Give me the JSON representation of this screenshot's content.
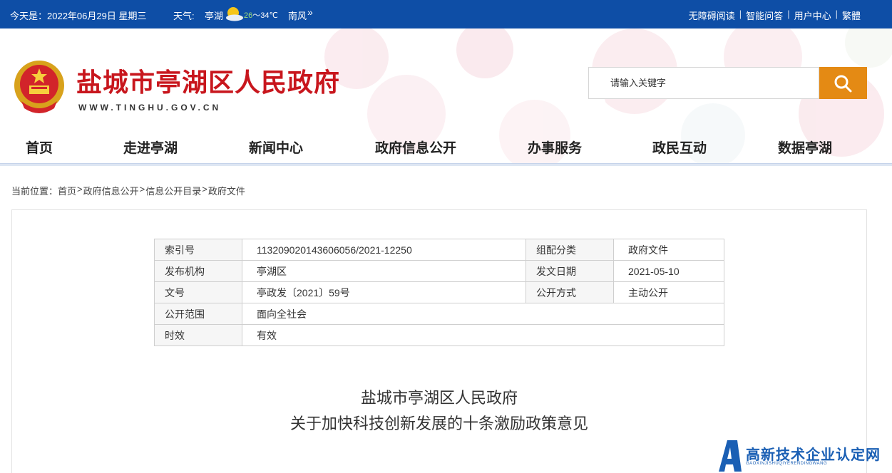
{
  "topbar": {
    "date": "今天是：2022年06月29日 星期三",
    "weather_label": "天气:",
    "location": "亭湖",
    "temp_low": "26",
    "temp_high": "～34℃",
    "wind": "南风",
    "more": "»",
    "links": [
      "无障碍阅读",
      "智能问答",
      "用户中心",
      "繁體"
    ],
    "separator": "|"
  },
  "header": {
    "site_title": "盐城市亭湖区人民政府",
    "site_url": "WWW.TINGHU.GOV.CN",
    "search_placeholder": "请输入关键字"
  },
  "nav": {
    "items": [
      "首页",
      "走进亭湖",
      "新闻中心",
      "政府信息公开",
      "办事服务",
      "政民互动",
      "数据亭湖"
    ]
  },
  "breadcrumb": {
    "prefix": "当前位置：",
    "items": [
      "首页",
      "政府信息公开",
      "信息公开目录",
      "政府文件"
    ],
    "separator": ">"
  },
  "meta_table": {
    "rows": [
      {
        "label": "索引号",
        "value": "113209020143606056/2021-12250",
        "label2": "组配分类",
        "value2": "政府文件"
      },
      {
        "label": "发布机构",
        "value": "亭湖区",
        "label2": "发文日期",
        "value2": "2021-05-10"
      },
      {
        "label": "文号",
        "value": "亭政发〔2021〕59号",
        "label2": "公开方式",
        "value2": "主动公开"
      },
      {
        "label": "公开范围",
        "value": "面向全社会"
      },
      {
        "label": "时效",
        "value": "有效"
      }
    ]
  },
  "document": {
    "title_line1": "盐城市亭湖区人民政府",
    "title_line2": "关于加快科技创新发展的十条激励政策意见"
  },
  "watermark": {
    "text": "高新技术企业认定网",
    "sub": "GAOXINJISHUQIYERENDINGWANG"
  },
  "colors": {
    "topbar_bg": "#0e4ea6",
    "title_red": "#c8161d",
    "search_btn": "#e48a14"
  }
}
